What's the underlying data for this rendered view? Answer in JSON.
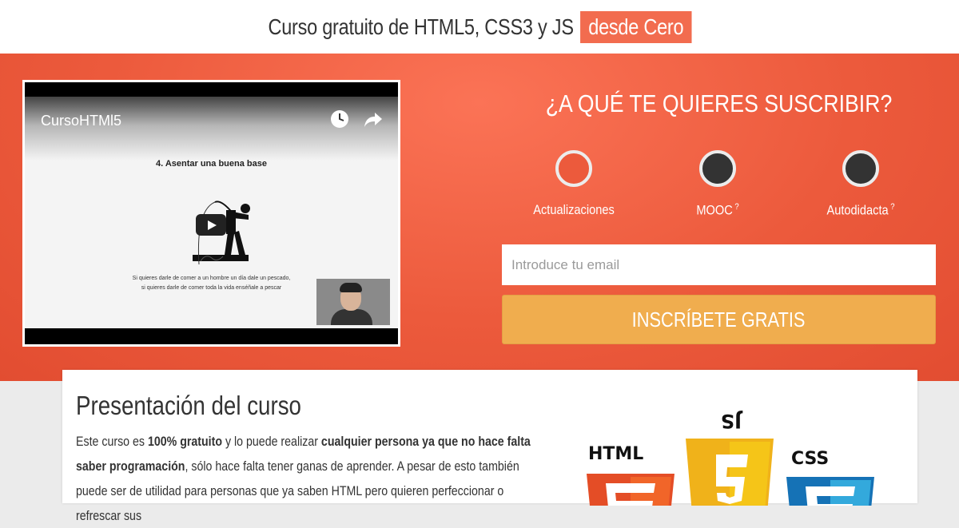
{
  "header": {
    "title": "Curso gratuito de HTML5, CSS3 y JS",
    "highlight": "desde Cero"
  },
  "video": {
    "title": "CursoHTMl5",
    "slide_heading": "4. Asentar una buena base",
    "slide_caption_line1": "Si quieres darle de comer a un hombre un día dale un pescado,",
    "slide_caption_line2": "si quieres darle de comer toda la vida enséñale a pescar",
    "icons": [
      "clock-icon",
      "share-icon",
      "play-icon"
    ]
  },
  "subscribe": {
    "title": "¿A QUÉ TE QUIERES SUSCRIBIR?",
    "options": [
      {
        "label": "Actualizaciones",
        "help": "",
        "selected": true
      },
      {
        "label": "MOOC",
        "help": "?",
        "selected": false
      },
      {
        "label": "Autodidacta",
        "help": "?",
        "selected": false
      }
    ],
    "email_placeholder": "Introduce tu email",
    "cta_label": "INSCRÍBETE GRATIS"
  },
  "presentation": {
    "title": "Presentación del curso",
    "p1": "Este curso es ",
    "b1": "100% gratuito",
    "p2": " y lo puede realizar ",
    "b2": "cualquier persona ya que no hace falta saber programación",
    "p3": ", sólo hace falta tener ganas de aprender. A pesar de esto también puede ser de utilidad para personas que ya saben HTML pero quieren perfeccionar o refrescar sus",
    "logo_labels": [
      "HTML",
      "JS",
      "CSS"
    ]
  },
  "colors": {
    "accent": "#f26c4f",
    "hero": "#ec5a3c",
    "cta": "#f0ad4e",
    "html5": "#e44d26",
    "js": "#f0b21a",
    "css3": "#1572b6"
  }
}
